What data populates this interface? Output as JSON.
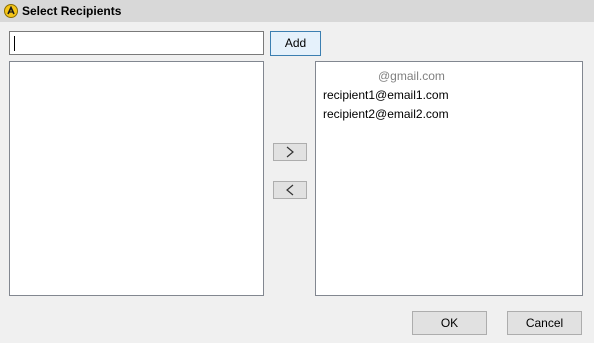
{
  "window": {
    "title": "Select Recipients",
    "icon": "app-logo-icon"
  },
  "search": {
    "value": "",
    "add_label": "Add"
  },
  "available_list": {
    "items": []
  },
  "move": {
    "right_icon": "chevron-right-icon",
    "left_icon": "chevron-left-icon"
  },
  "selected_list": {
    "placeholder": "@gmail.com",
    "items": [
      "recipient1@email1.com",
      "recipient2@email2.com"
    ]
  },
  "footer": {
    "ok_label": "OK",
    "cancel_label": "Cancel"
  }
}
